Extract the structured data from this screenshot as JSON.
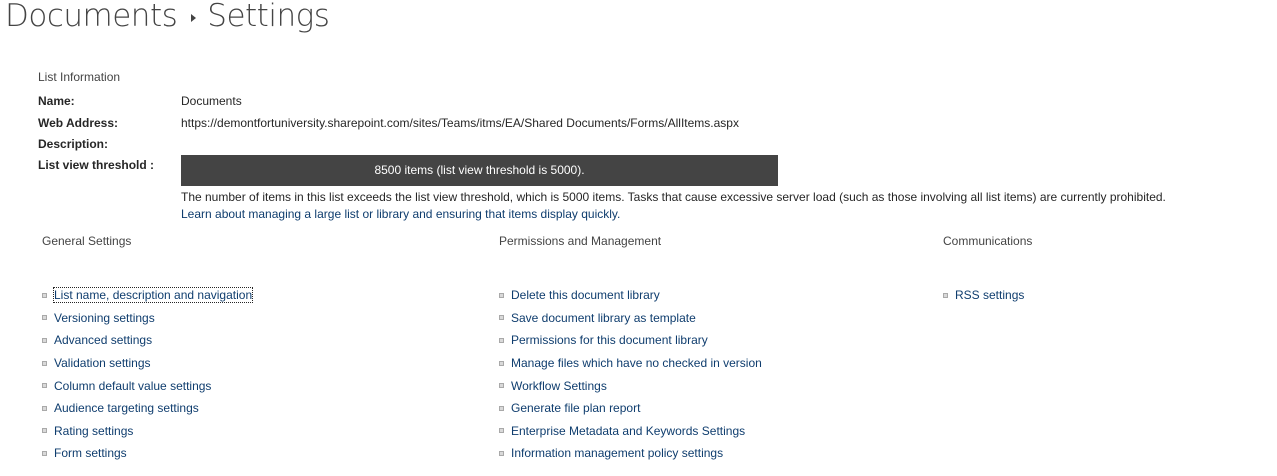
{
  "breadcrumb": {
    "parent": "Documents",
    "current": "Settings"
  },
  "list_information": {
    "heading": "List Information",
    "name_label": "Name:",
    "name_value": "Documents",
    "web_address_label": "Web Address:",
    "web_address_value": "https://demontfortuniversity.sharepoint.com/sites/Teams/itms/EA/Shared Documents/Forms/AllItems.aspx",
    "description_label": "Description:",
    "description_value": "",
    "threshold_label": "List view threshold :",
    "threshold_bar_text": "8500 items (list view threshold is 5000).",
    "threshold_note": "The number of items in this list exceeds the list view threshold, which is 5000 items. Tasks that cause excessive server load (such as those involving all list items) are currently prohibited.",
    "learn_link": "Learn about managing a large list or library and ensuring that items display quickly."
  },
  "general_settings": {
    "heading": "General Settings",
    "items": [
      "List name, description and navigation",
      "Versioning settings",
      "Advanced settings",
      "Validation settings",
      "Column default value settings",
      "Audience targeting settings",
      "Rating settings",
      "Form settings"
    ]
  },
  "permissions": {
    "heading": "Permissions and Management",
    "items": [
      "Delete this document library",
      "Save document library as template",
      "Permissions for this document library",
      "Manage files which have no checked in version",
      "Workflow Settings",
      "Generate file plan report",
      "Enterprise Metadata and Keywords Settings",
      "Information management policy settings"
    ]
  },
  "communications": {
    "heading": "Communications",
    "items": [
      "RSS settings"
    ]
  },
  "colors": {
    "link": "#0f3d6e",
    "threshold_bar_bg": "#444444",
    "text": "#262626"
  }
}
